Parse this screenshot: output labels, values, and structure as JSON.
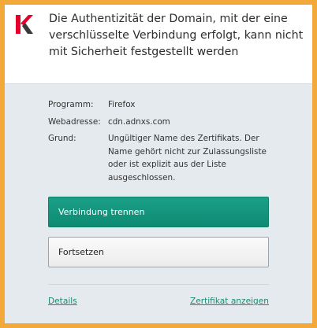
{
  "header": {
    "logo_icon": "kaspersky-k-logo",
    "title": "Die Authentizität der Domain, mit der eine verschlüsselte Verbindung erfolgt, kann nicht mit Sicherheit festgestellt werden"
  },
  "details": {
    "program": {
      "label": "Programm:",
      "value": "Firefox"
    },
    "address": {
      "label": "Webadresse:",
      "value": "cdn.adnxs.com"
    },
    "reason": {
      "label": "Grund:",
      "value": "Ungültiger Name des Zertifikats. Der Name gehört nicht zur Zulassungsliste oder ist explizit aus der Liste ausgeschlossen."
    }
  },
  "actions": {
    "disconnect_label": "Verbindung trennen",
    "continue_label": "Fortsetzen"
  },
  "links": {
    "details_label": "Details",
    "show_cert_label": "Zertifikat anzeigen"
  },
  "colors": {
    "accent": "#129378",
    "frame": "#f3a83a",
    "background": "#e4eaee",
    "logo_red": "#e4002b"
  }
}
